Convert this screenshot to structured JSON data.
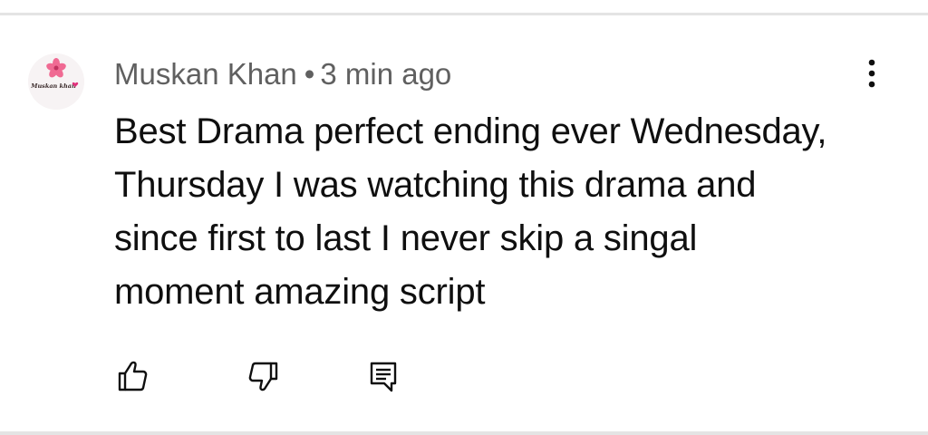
{
  "comment": {
    "author": "Muskan Khan",
    "separator": "•",
    "time": "3 min ago",
    "avatar_text": "Muskan khan",
    "text_lines": [
      "Best Drama perfect ending ever Wednesday,",
      "Thursday I was watching this drama and",
      "since first to last I never skip a singal",
      "moment amazing script"
    ]
  },
  "icons": {
    "avatar": "flower-avatar",
    "more": "more-vertical-icon",
    "like": "thumbs-up-icon",
    "dislike": "thumbs-down-icon",
    "reply": "reply-comment-icon"
  },
  "colors": {
    "meta_text": "#606060",
    "body_text": "#0f0f0f",
    "icon": "#0f0f0f",
    "divider": "#e4e4e4",
    "avatar_flower": "#f06a93"
  }
}
